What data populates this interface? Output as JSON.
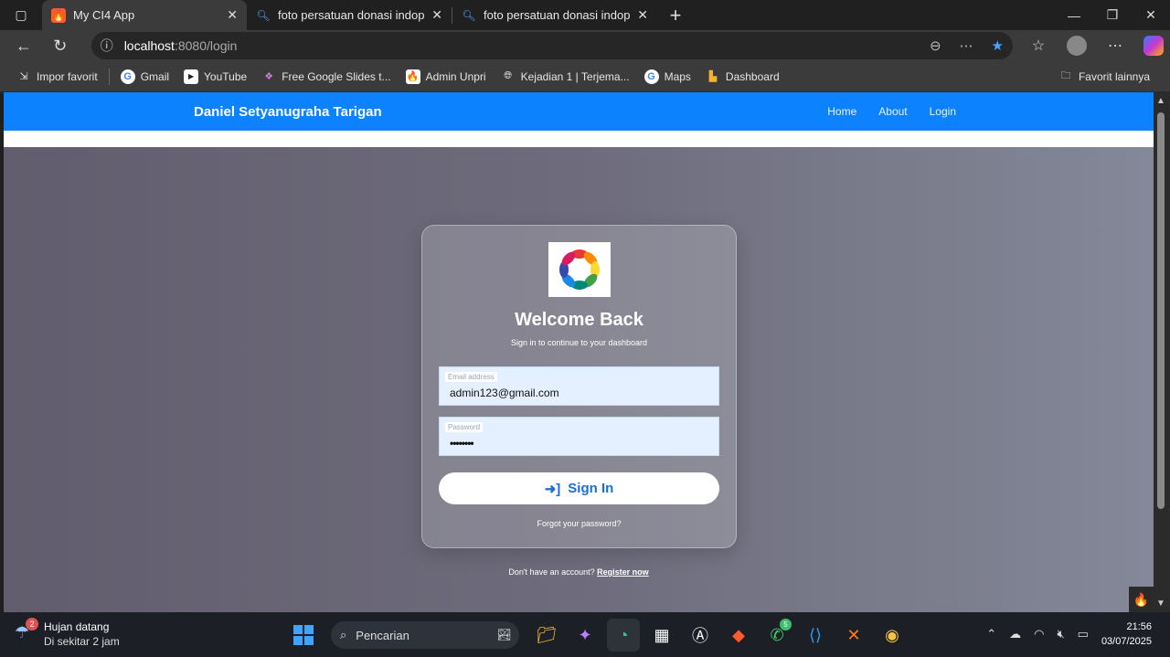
{
  "browser": {
    "tabs": [
      {
        "title": "My CI4 App",
        "favicon": "codeigniter-icon"
      },
      {
        "title": "foto persatuan donasi indopride -",
        "favicon": "search-icon"
      },
      {
        "title": "foto persatuan donasi indopride -",
        "favicon": "search-icon"
      }
    ],
    "url_host": "localhost",
    "url_rest": ":8080/login",
    "bookmarks": [
      {
        "label": "Impor favorit",
        "icon": "import-icon"
      },
      {
        "label": "Gmail",
        "icon": "google-icon"
      },
      {
        "label": "YouTube",
        "icon": "youtube-icon"
      },
      {
        "label": "Free Google Slides t...",
        "icon": "slides-icon"
      },
      {
        "label": "Admin Unpri",
        "icon": "codeigniter-icon"
      },
      {
        "label": "Kejadian 1 | Terjema...",
        "icon": "globe-icon"
      },
      {
        "label": "Maps",
        "icon": "google-icon"
      },
      {
        "label": "Dashboard",
        "icon": "dashboard-icon"
      }
    ],
    "other_favorites": "Favorit lainnya"
  },
  "page": {
    "brand": "Daniel Setyanugraha Tarigan",
    "nav": {
      "home": "Home",
      "about": "About",
      "login": "Login"
    },
    "login": {
      "title": "Welcome Back",
      "subtitle": "Sign in to continue to your dashboard",
      "email_label": "Email address",
      "email_value": "admin123@gmail.com",
      "password_label": "Password",
      "password_value": "••••••••",
      "signin_label": "Sign In",
      "forgot": "Forgot your password?"
    },
    "register_prompt": "Don't have an account?",
    "register_link": "Register now",
    "colors": {
      "navbar": "#0d82ff",
      "button_text": "#1a6fd6"
    }
  },
  "taskbar": {
    "weather_title": "Hujan datang",
    "weather_sub": "Di sekitar 2 jam",
    "weather_badge": "2",
    "search_placeholder": "Pencarian",
    "whatsapp_badge": "5",
    "time": "21:56",
    "date": "03/07/2025"
  }
}
